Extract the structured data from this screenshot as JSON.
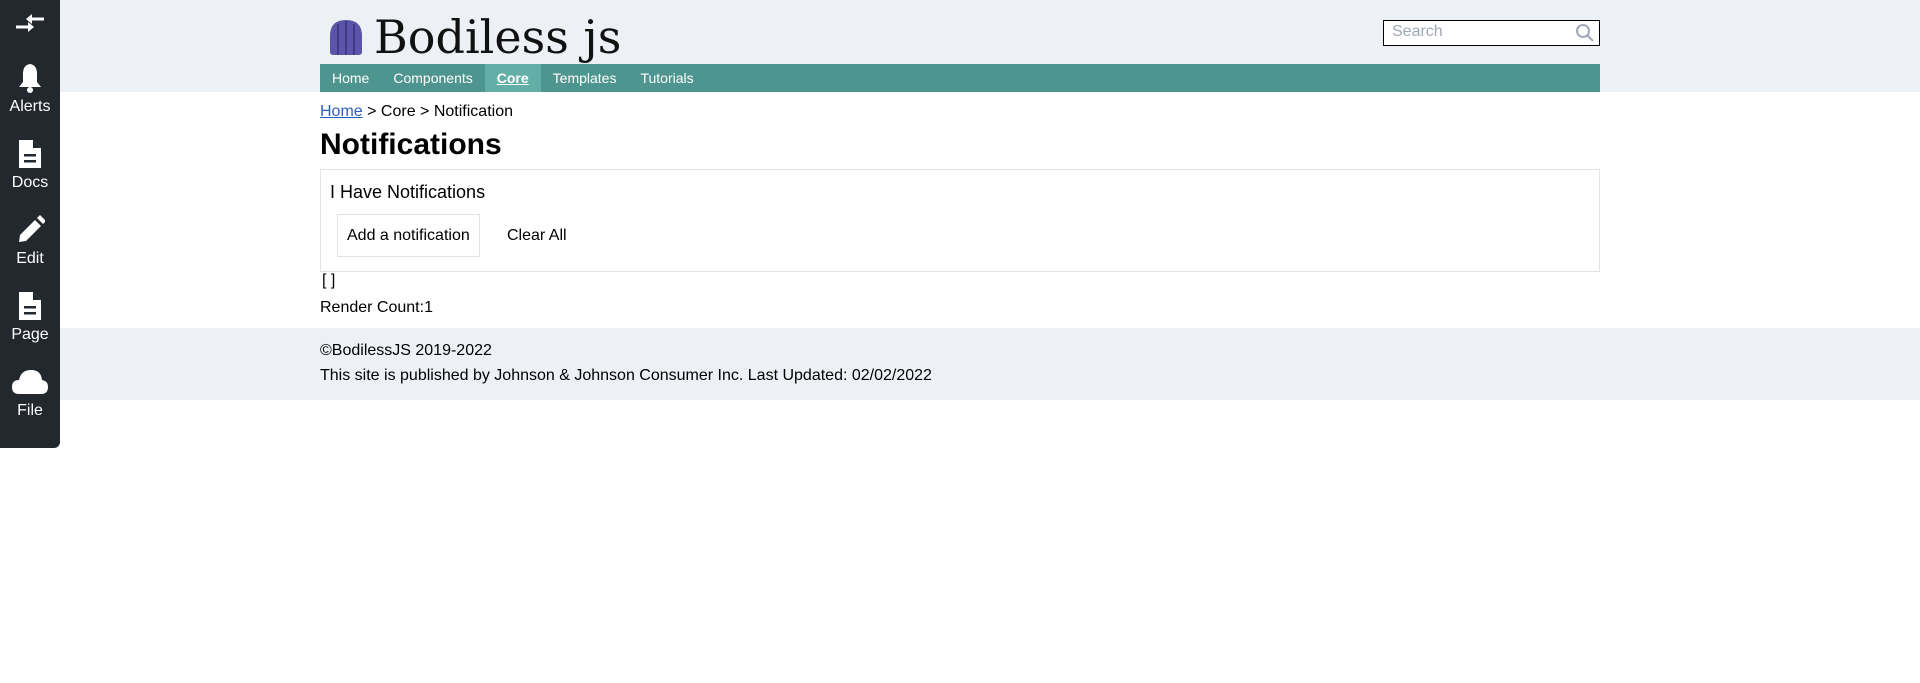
{
  "sidebar": {
    "collapse_icon": "arrows-collapse-icon",
    "items": [
      {
        "label": "Alerts",
        "icon": "bell-icon"
      },
      {
        "label": "Docs",
        "icon": "document-icon"
      },
      {
        "label": "Edit",
        "icon": "pencil-icon"
      },
      {
        "label": "Page",
        "icon": "document-icon"
      },
      {
        "label": "File",
        "icon": "cloud-icon"
      }
    ]
  },
  "header": {
    "logo_text": "Bodiless js",
    "search_placeholder": "Search"
  },
  "nav": {
    "items": [
      "Home",
      "Components",
      "Core",
      "Templates",
      "Tutorials"
    ],
    "active": "Core"
  },
  "breadcrumb": {
    "home": "Home",
    "rest": " > Core > Notification"
  },
  "main": {
    "title": "Notifications",
    "box_title": "I Have Notifications",
    "add_button": "Add a notification",
    "clear_button": "Clear All",
    "array_text": "[ ]",
    "render_count": "Render Count:1"
  },
  "footer": {
    "copyright": "©BodilessJS 2019-2022",
    "published": "This site is published by Johnson & Johnson Consumer Inc. Last Updated: 02/02/2022"
  },
  "colors": {
    "nav": "#4e9590",
    "nav_active": "#63afa8",
    "sidebar": "#23272e",
    "header_bg": "#edf0f5"
  }
}
